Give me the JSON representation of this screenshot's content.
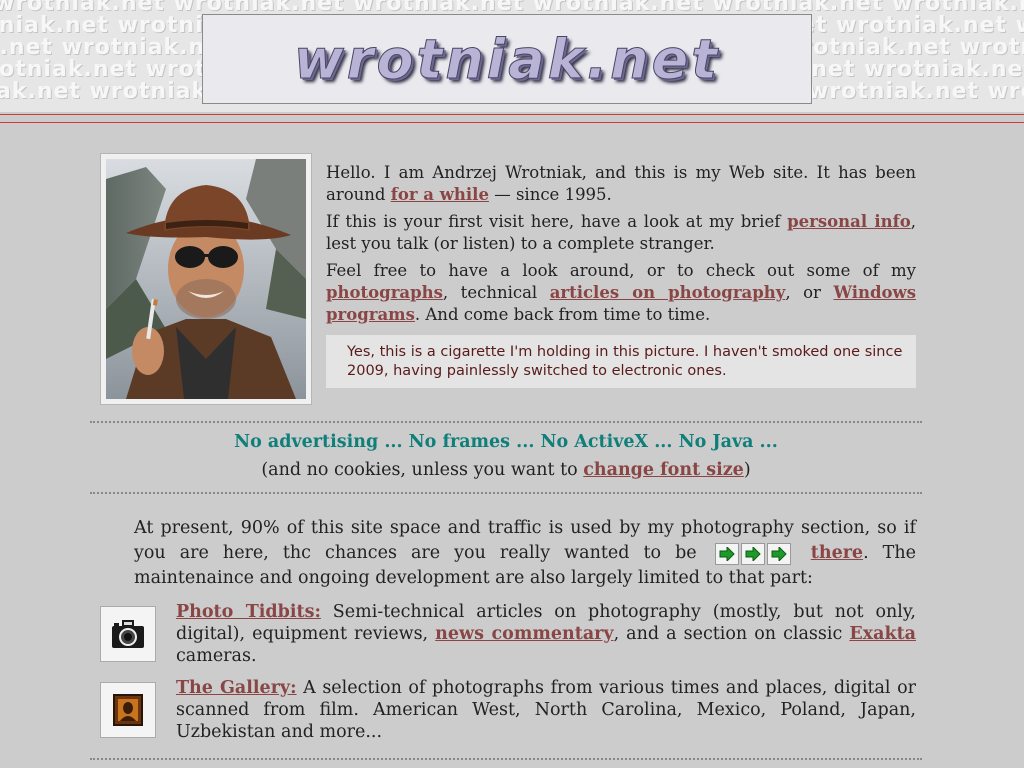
{
  "header": {
    "site_logo": "wrotniak.net",
    "pattern_text": "wrotniak.net wrotniak.net wrotniak.net wrotniak.net wrotniak.net wrotniak.net wrotniak.net wrotniak.net"
  },
  "intro": {
    "p1_before": "Hello. I am Andrzej Wrotniak, and this is my Web site. It has been around ",
    "p1_link": "for a while",
    "p1_after": " — since 1995.",
    "p2_before": "If this is your first visit here, have a look at my brief ",
    "p2_link": "personal info",
    "p2_after": ", lest you talk (or listen) to a complete stranger.",
    "p3_before": "Feel free to have a look around, or to check out some of my ",
    "p3_link1": "photographs",
    "p3_mid1": ", technical ",
    "p3_link2": "articles on photography",
    "p3_mid2": ", or ",
    "p3_link3": "Windows programs",
    "p3_after": ". And come back from time to time.",
    "note": "Yes, this is a cigarette I'm holding in this picture. I haven't smoked one since 2009, having painlessly switched to electronic ones."
  },
  "slogan": {
    "line": "No advertising ... No frames ... No ActiveX ... No Java ...",
    "cookies_before": "(and no cookies, unless you want to ",
    "cookies_link": "change font size",
    "cookies_after": ")"
  },
  "present": {
    "before": "At present, 90% of this site space and traffic is used by my photography section, so if you are here, thc chances are you really wanted to be",
    "link": "there",
    "after": ". The maintenaince and ongoing development are also largely limited to that part:"
  },
  "sections": [
    {
      "title": "Photo Tidbits:",
      "text1": " Semi-technical articles on photography (mostly, but not only, digital), equipment reviews, ",
      "link1": "news commentary",
      "text2": ", and a section on classic ",
      "link2": "Exakta",
      "text3": " cameras."
    },
    {
      "title": "The Gallery:",
      "text1": " A selection of photographs from various times and places, digital or scanned from film. American West, North Carolina, Mexico, Poland, Japan, Uzbekistan and more..."
    }
  ],
  "icons": {
    "camera": "camera-icon",
    "gallery": "framed-picture-icon",
    "arrow": "arrow-right-icon"
  },
  "colors": {
    "background": "#cccccc",
    "link": "#8a4545",
    "slogan": "#0f7f7a",
    "rule": "#cc3a3a"
  }
}
